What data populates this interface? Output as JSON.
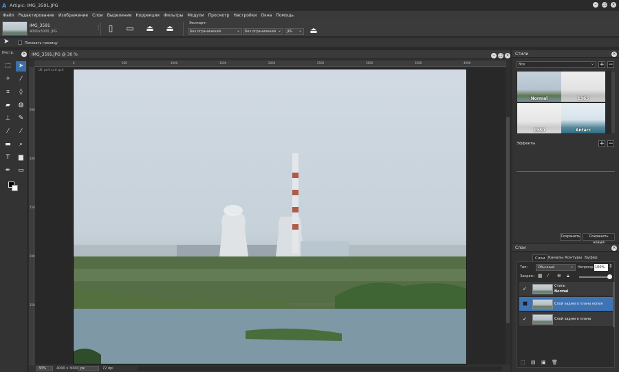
{
  "window": {
    "title": "Artipic: IMG_3591.JPG",
    "logo": "A"
  },
  "menu": [
    "Файл",
    "Редактирование",
    "Изображение",
    "Слои",
    "Выделение",
    "Коррекция",
    "Фильтры",
    "Модули",
    "Просмотр",
    "Настройки",
    "Окна",
    "Помощь"
  ],
  "document": {
    "name": "IMG_3591",
    "size": "4000x3000, JPG"
  },
  "export": {
    "label": "Экспорт:",
    "size1": "Без ограничений",
    "size2": "Без ограничений",
    "format": "JPG"
  },
  "options": {
    "show_bounds_label": "Показать границу"
  },
  "toolbox": {
    "label": "Инстр."
  },
  "canvas": {
    "tab_title": "IMG_3591.JPG @ 30 %",
    "ruler_top": [
      "0",
      "500",
      "1000",
      "1500",
      "2000",
      "2500",
      "3000",
      "3500",
      "4000"
    ],
    "ruler_left": [
      "500",
      "1000",
      "1500",
      "2000",
      "2500"
    ],
    "layer_hint": "UE: ре:0 сс:0 ср:0"
  },
  "status": {
    "zoom": "30%",
    "dimensions": "4000 x 3000",
    "unit": "px",
    "dpi": "72 dpi"
  },
  "styles_panel": {
    "title": "Стили",
    "filter": "Все",
    "thumbs": [
      "Normal",
      "1965",
      "1980",
      "Antarc"
    ],
    "effects_label": "Эффекты",
    "save_button": "Сохранить",
    "save_new_button": "Сохранить новый"
  },
  "layers_panel": {
    "title": "Слои",
    "tabs": [
      "Слои",
      "Каналы",
      "Контуры",
      "Буфер"
    ],
    "type_label": "Тип:",
    "blend_mode": "Обычный",
    "opacity_label": "Непрозр.:",
    "opacity": "100%",
    "lock_label": "Закреп.:",
    "layers": [
      {
        "name": "Стиль",
        "sub": "Normal",
        "checked": true,
        "selected": false
      },
      {
        "name": "Слой заднего плана копия",
        "checked": false,
        "selected": true
      },
      {
        "name": "Слой заднего плана",
        "checked": true,
        "selected": false
      }
    ]
  },
  "colors": {
    "accent": "#3e74b5",
    "sky": "#cdd6de",
    "water": "#7e98a6"
  }
}
